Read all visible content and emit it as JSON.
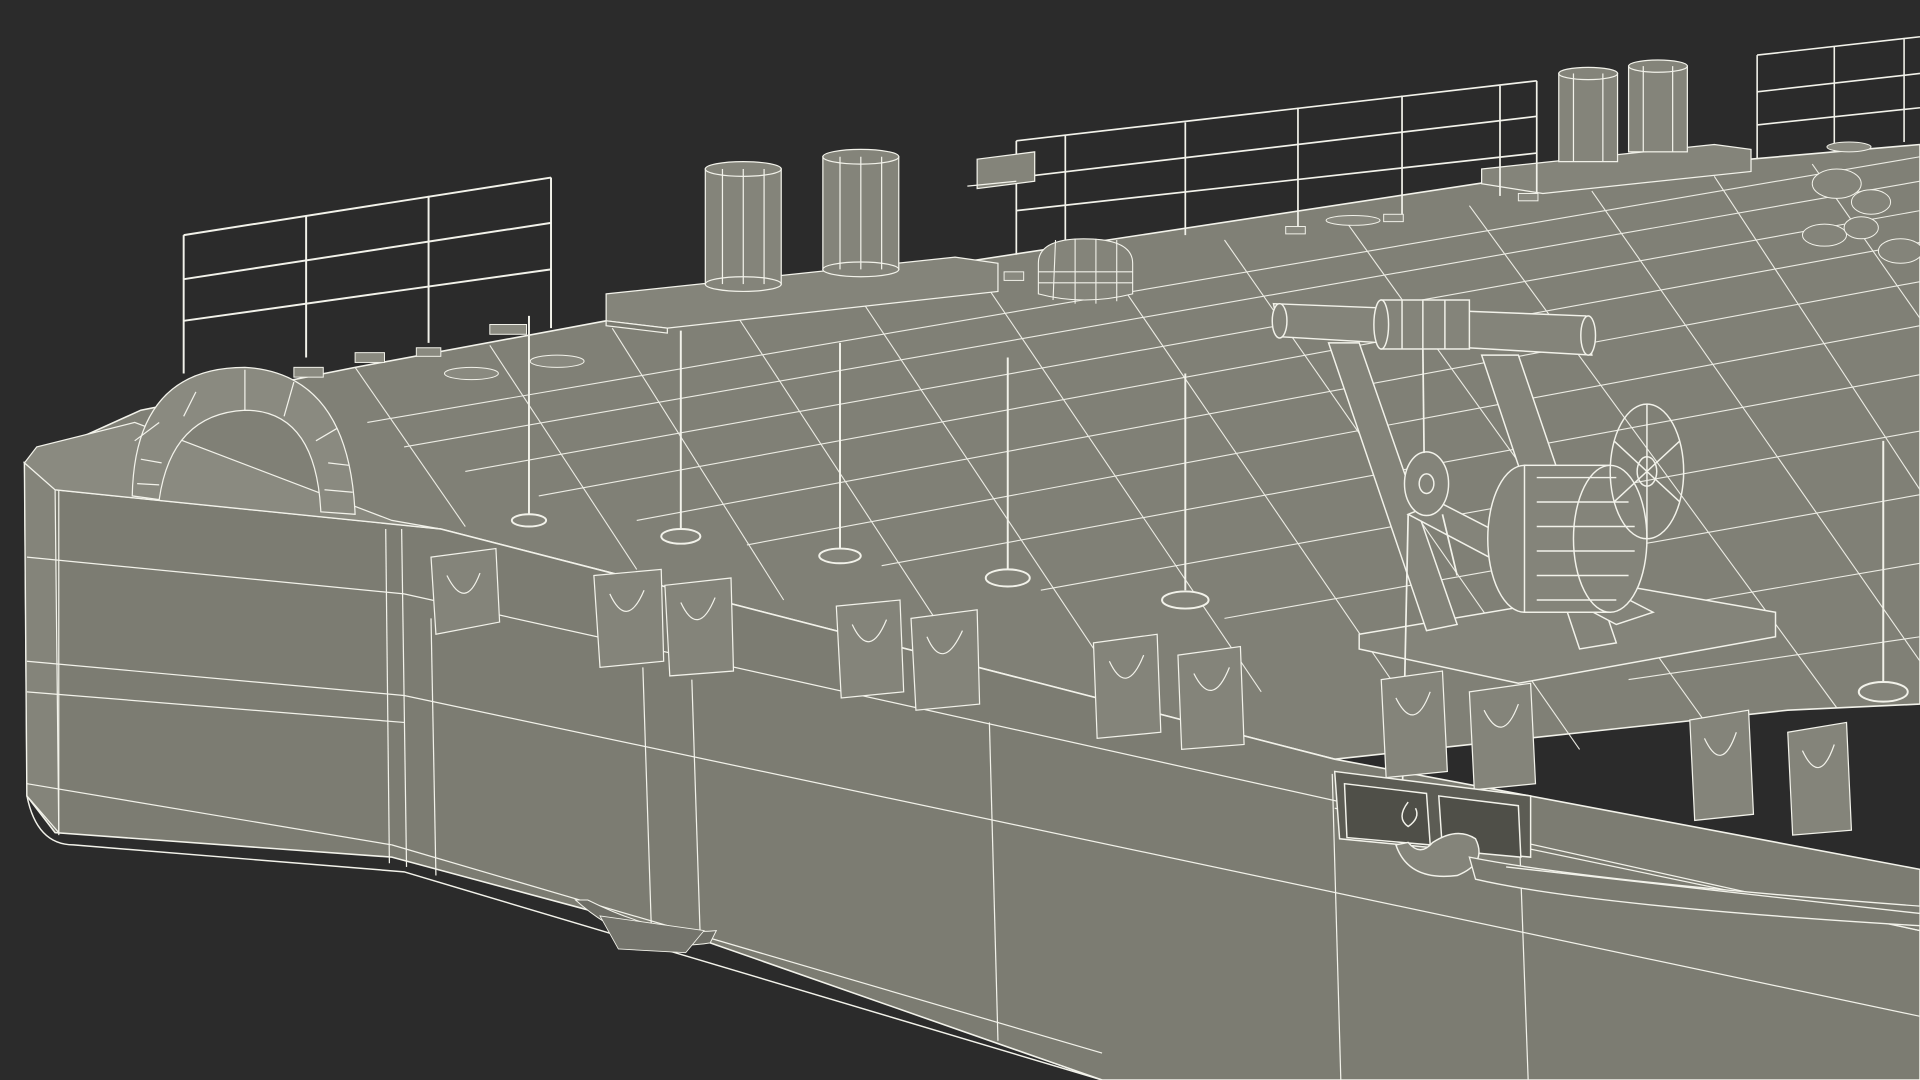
{
  "scene": {
    "subject": "barge-deck-wireframe-render",
    "render_style": "wireframe-over-shaded",
    "colors": {
      "background": "#2b2b2b",
      "hull_side": "#7c7c72",
      "hull_side_light": "#84847a",
      "deck": "#808076",
      "deck_far": "#8a8a80",
      "wire": "#f2f2ea",
      "wire_dim": "#d8d8ce",
      "shadow": "#5c5c54"
    }
  }
}
